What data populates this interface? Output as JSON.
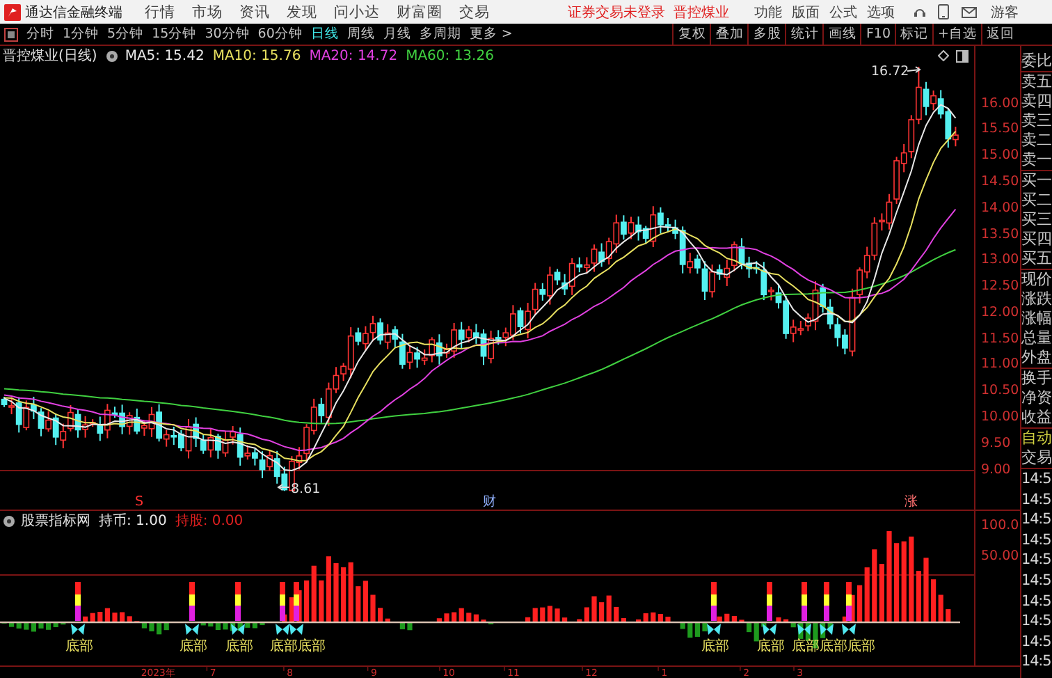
{
  "app": {
    "title": "通达信金融终端"
  },
  "menu": [
    "行情",
    "市场",
    "资讯",
    "发现",
    "问小达",
    "财富圈",
    "交易"
  ],
  "login_status": "证券交易未登录",
  "stock_link": "晋控煤业",
  "right_menu": [
    "功能",
    "版面",
    "公式",
    "选项"
  ],
  "user": "游客",
  "periods": [
    {
      "label": "分时",
      "selected": false
    },
    {
      "label": "1分钟",
      "selected": false
    },
    {
      "label": "5分钟",
      "selected": false
    },
    {
      "label": "15分钟",
      "selected": false
    },
    {
      "label": "30分钟",
      "selected": false
    },
    {
      "label": "60分钟",
      "selected": false
    },
    {
      "label": "日线",
      "selected": true
    },
    {
      "label": "周线",
      "selected": false
    },
    {
      "label": "月线",
      "selected": false
    },
    {
      "label": "多周期",
      "selected": false
    },
    {
      "label": "更多 >",
      "selected": false
    }
  ],
  "tools": [
    "复权",
    "叠加",
    "多股",
    "统计",
    "画线",
    "F10",
    "标记",
    "+自选",
    "返回"
  ],
  "chart": {
    "title": "晋控煤业(日线)",
    "indicators": [
      {
        "label": "MA5: 15.42",
        "color": "#e8e8e8"
      },
      {
        "label": "MA10: 15.76",
        "color": "#e8e060"
      },
      {
        "label": "MA20: 14.72",
        "color": "#e040e0"
      },
      {
        "label": "MA60: 13.26",
        "color": "#40d040"
      }
    ],
    "high_label": "16.72",
    "low_label": "8.61",
    "event_marks": [
      {
        "text": "S",
        "color": "#ff3030"
      },
      {
        "text": "财",
        "color": "#90b0ff"
      },
      {
        "text": "涨",
        "color": "#ff7070"
      }
    ],
    "yticks": [
      "16.00",
      "15.50",
      "15.00",
      "14.50",
      "14.00",
      "13.50",
      "13.00",
      "12.50",
      "12.00",
      "11.50",
      "11.00",
      "10.50",
      "10.00",
      "9.50",
      "9.00"
    ]
  },
  "indicator": {
    "title": "股票指标网",
    "values": [
      {
        "label": "持币: 1.00",
        "color": "#e8e8e8"
      },
      {
        "label": "持股: 0.00",
        "color": "#e02020"
      }
    ],
    "yticks": [
      "100.0",
      "50.00"
    ],
    "signals": [
      "底部",
      "底部",
      "底部",
      "底部",
      "底部",
      "底部",
      "底部",
      "底部",
      "底部",
      "底部"
    ]
  },
  "xaxis": [
    "2023年",
    "7",
    "8",
    "9",
    "10",
    "11",
    "12",
    "1",
    "2",
    "3"
  ],
  "quote_panel": {
    "groups": [
      [
        "委比"
      ],
      [
        "卖五",
        "卖四",
        "卖三",
        "卖二",
        "卖一"
      ],
      [
        "买一",
        "买二",
        "买三",
        "买四",
        "买五"
      ],
      [
        "现价",
        "涨跌",
        "涨幅",
        "总量",
        "外盘"
      ],
      [
        "换手",
        "净资",
        "收益"
      ]
    ],
    "actions": [
      {
        "text": "自动",
        "highlighted": true
      },
      {
        "text": "交易",
        "highlighted": false
      }
    ],
    "times": [
      "14:5",
      "14:5",
      "14:5",
      "14:5",
      "14:5",
      "14:5",
      "14:5",
      "14:5",
      "14:5",
      "14:5"
    ]
  }
}
